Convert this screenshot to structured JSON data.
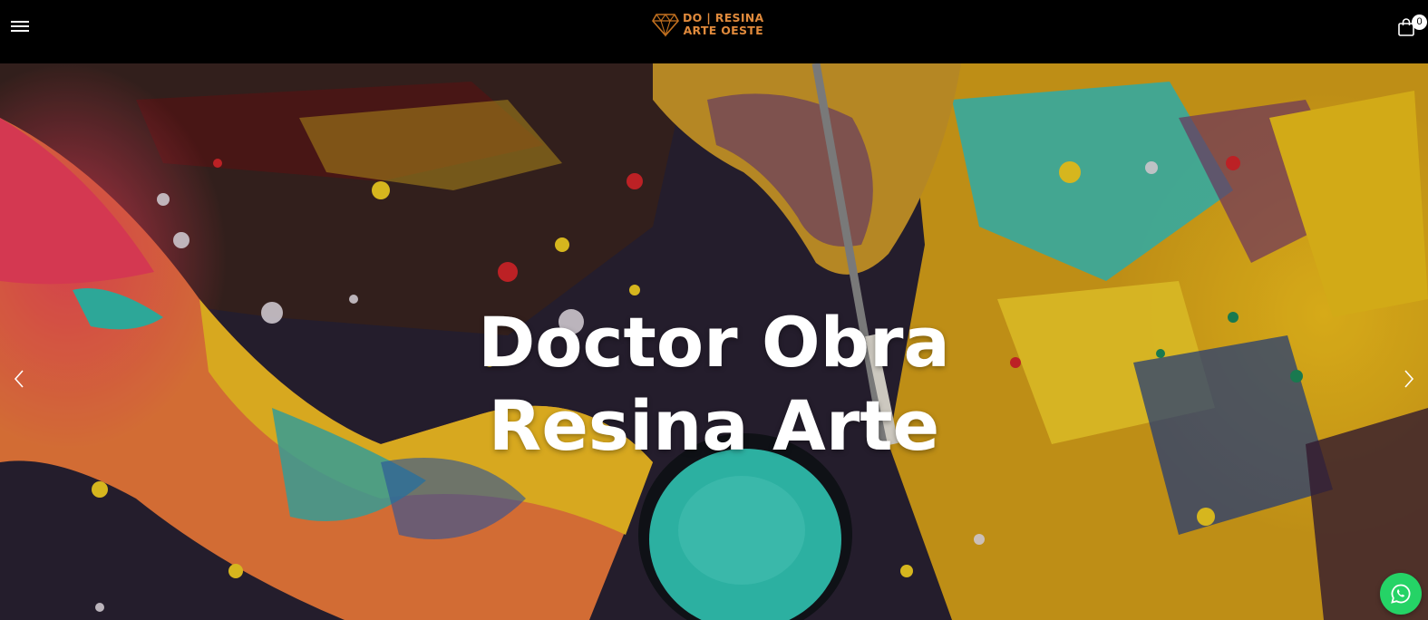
{
  "header": {
    "menu_icon": "hamburger-menu-icon",
    "logo": {
      "icon": "diamond-icon",
      "line1": "DO | RESINA",
      "line2": "ARTE OESTE",
      "color": "#e08a3c"
    },
    "cart": {
      "icon": "shopping-bag-icon",
      "count": "0"
    }
  },
  "hero": {
    "title_line1": "Doctor Obra",
    "title_line2": "Resina Arte",
    "prev_icon": "chevron-left-icon",
    "next_icon": "chevron-right-icon"
  },
  "whatsapp": {
    "icon": "whatsapp-icon",
    "color": "#25d366"
  }
}
